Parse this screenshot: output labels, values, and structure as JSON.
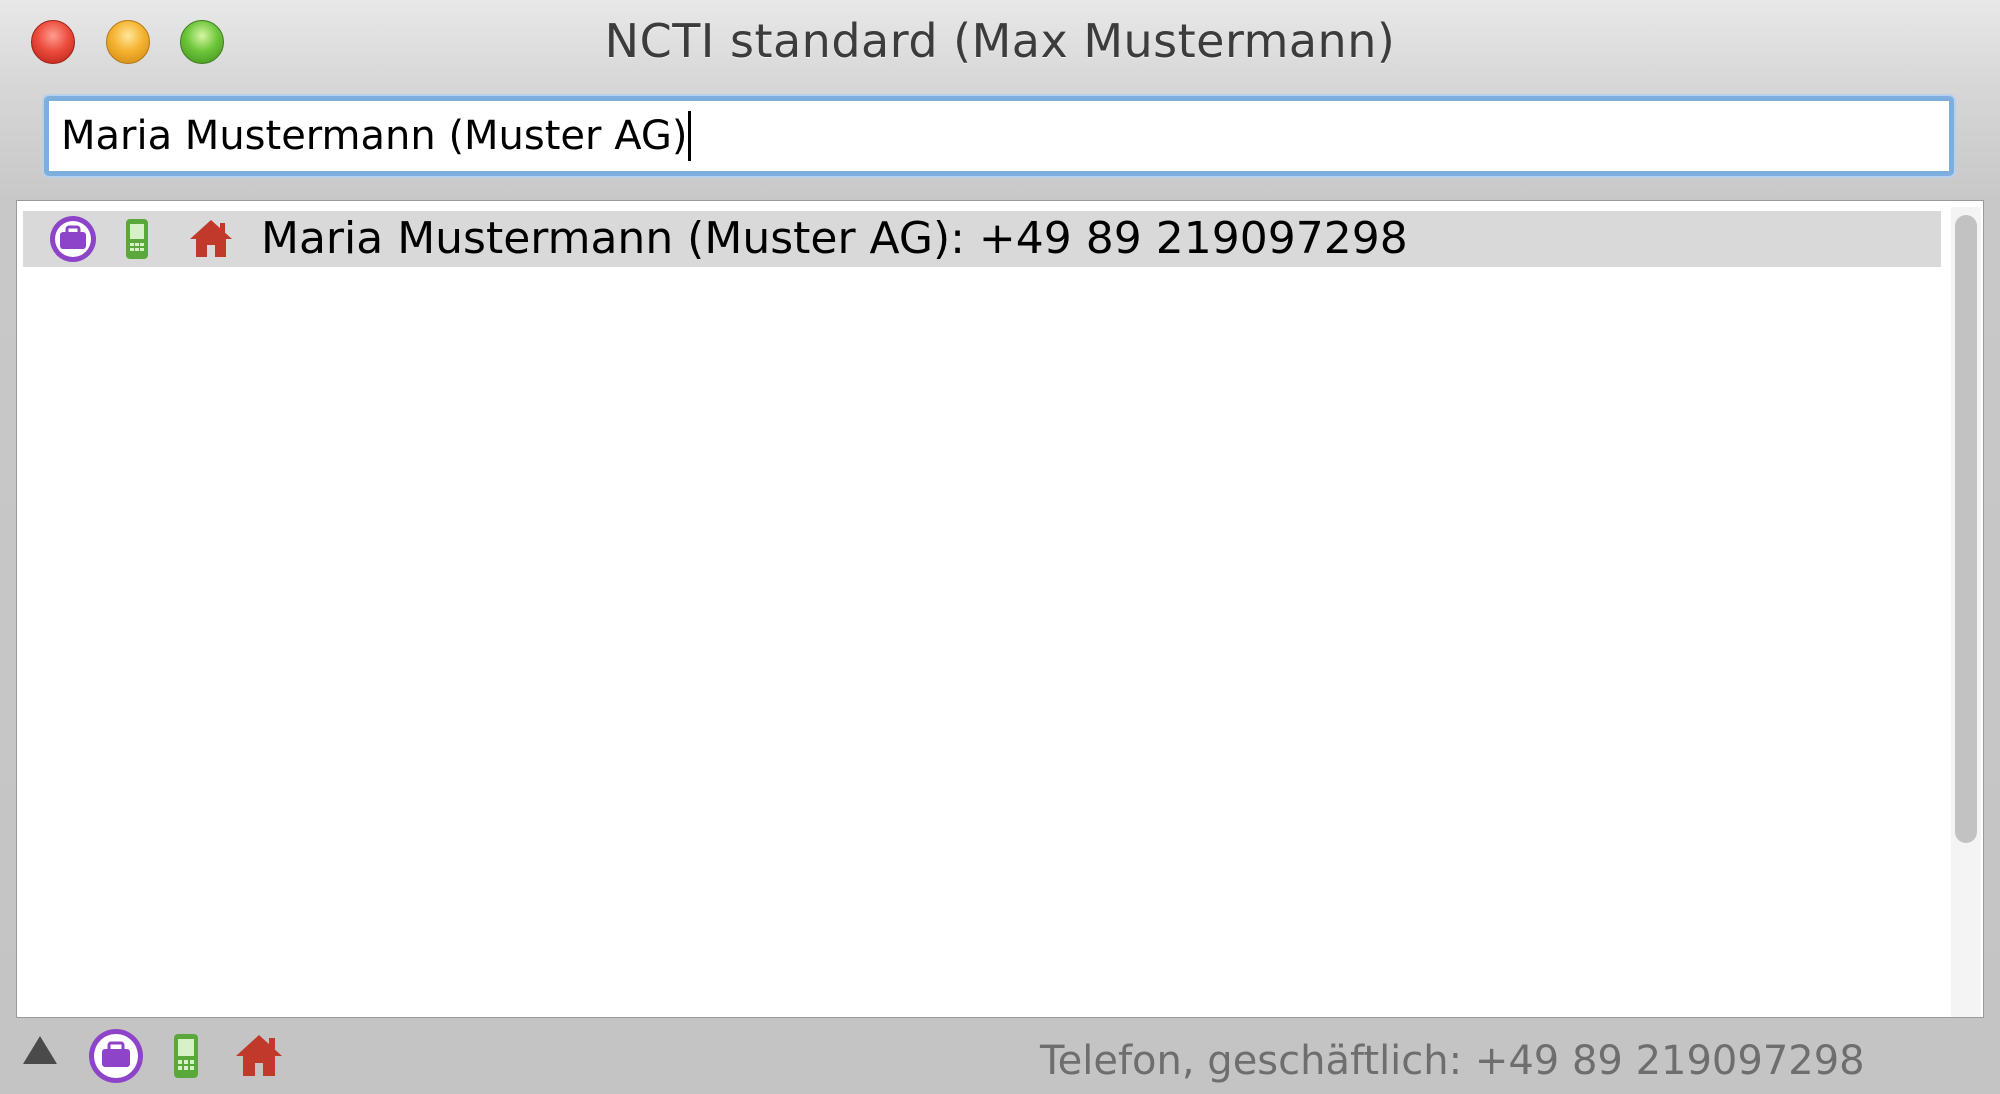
{
  "window": {
    "title": "NCTI standard (Max Mustermann)"
  },
  "search": {
    "value": "Maria Mustermann (Muster AG)"
  },
  "results": [
    {
      "text": "Maria Mustermann (Muster AG): +49 89 219097298",
      "icons": [
        "briefcase-icon",
        "mobile-phone-icon",
        "home-icon"
      ]
    }
  ],
  "status_bar": {
    "icons": [
      "triangle-up-icon",
      "briefcase-icon",
      "mobile-phone-icon",
      "home-icon"
    ],
    "text": "Telefon, geschäftlich: +49 89 219097298"
  },
  "colors": {
    "business": "#8e44c8",
    "mobile": "#5aa83c",
    "home": "#c0392b",
    "selection": "#d9d9d9",
    "focus_ring": "#7eaede"
  }
}
